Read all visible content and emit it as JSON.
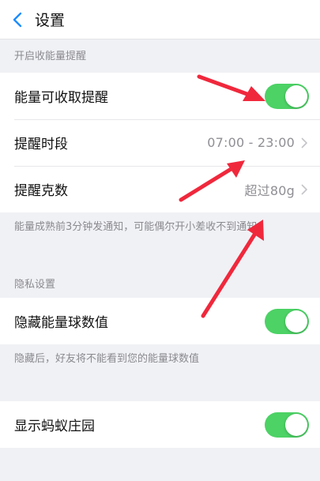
{
  "nav": {
    "title": "设置"
  },
  "energy": {
    "header": "开启收能量提醒",
    "rows": [
      {
        "label": "能量可收取提醒",
        "toggle": true
      },
      {
        "label": "提醒时段",
        "value": "07:00 - 23:00"
      },
      {
        "label": "提醒克数",
        "value": "超过80g"
      }
    ],
    "footnote": "能量成熟前3分钟发通知，可能偶尔开小差收不到通知"
  },
  "privacy": {
    "header": "隐私设置",
    "rows": [
      {
        "label": "隐藏能量球数值",
        "toggle": true
      }
    ],
    "footnote": "隐藏后，好友将不能看到您的能量球数值"
  },
  "bottom": {
    "rows": [
      {
        "label": "显示蚂蚁庄园",
        "toggle": true
      }
    ]
  },
  "colors": {
    "toggle_on": "#4cd265",
    "back_icon": "#1a8cff",
    "annotation_arrow": "#f0283c"
  },
  "icons": [
    "back-chevron-icon",
    "chevron-right-icon",
    "annotation-arrow"
  ]
}
